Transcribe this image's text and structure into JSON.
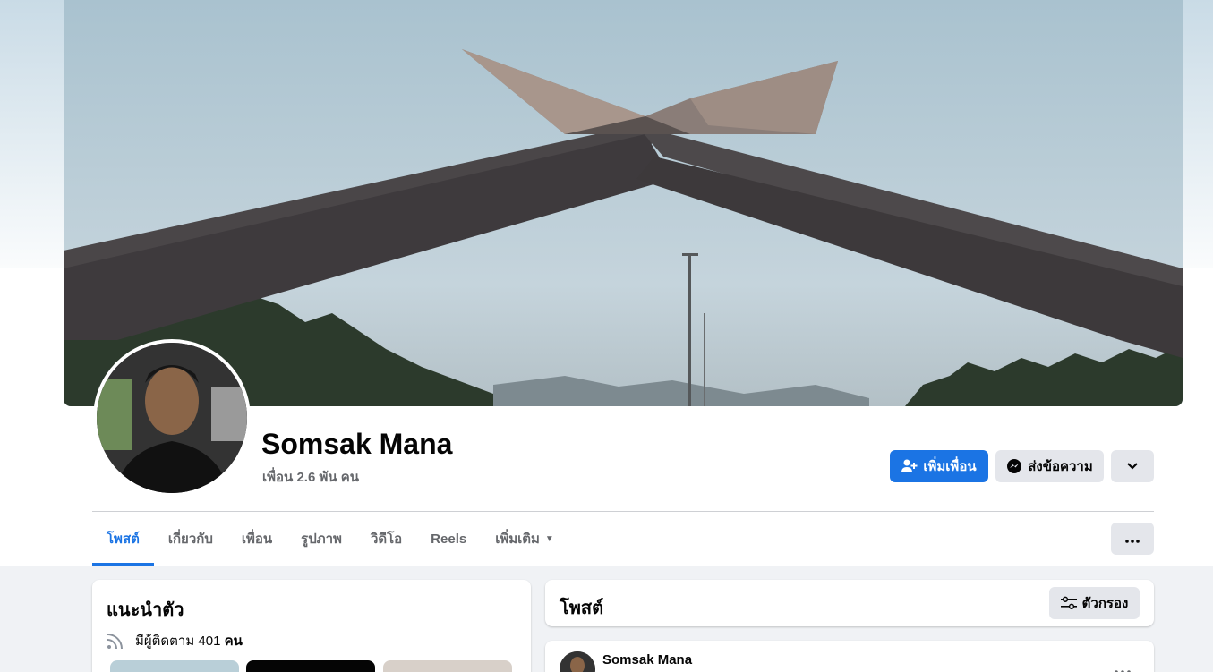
{
  "profile": {
    "name": "Somsak Mana",
    "friends_count": "เพื่อน 2.6 พัน คน"
  },
  "actions": {
    "add_friend_label": "เพิ่มเพื่อน",
    "message_label": "ส่งข้อความ",
    "more_icon": "chevron-down-icon"
  },
  "tabs": [
    {
      "label": "โพสต์",
      "active": true
    },
    {
      "label": "เกี่ยวกับ"
    },
    {
      "label": "เพื่อน"
    },
    {
      "label": "รูปภาพ"
    },
    {
      "label": "วิดีโอ"
    },
    {
      "label": "Reels"
    },
    {
      "label": "เพิ่มเติม"
    }
  ],
  "intro": {
    "title": "แนะนำตัว",
    "followers_prefix": "มีผู้ติดตาม 401 ",
    "followers_suffix": "คน"
  },
  "posts": {
    "title": "โพสต์",
    "filter_label": "ตัวกรอง",
    "first_post_author": "Somsak Mana"
  },
  "colors": {
    "accent": "#1b74e4",
    "background": "#f0f2f5",
    "secondary_button": "#e4e6eb",
    "muted_text": "#65676b"
  }
}
